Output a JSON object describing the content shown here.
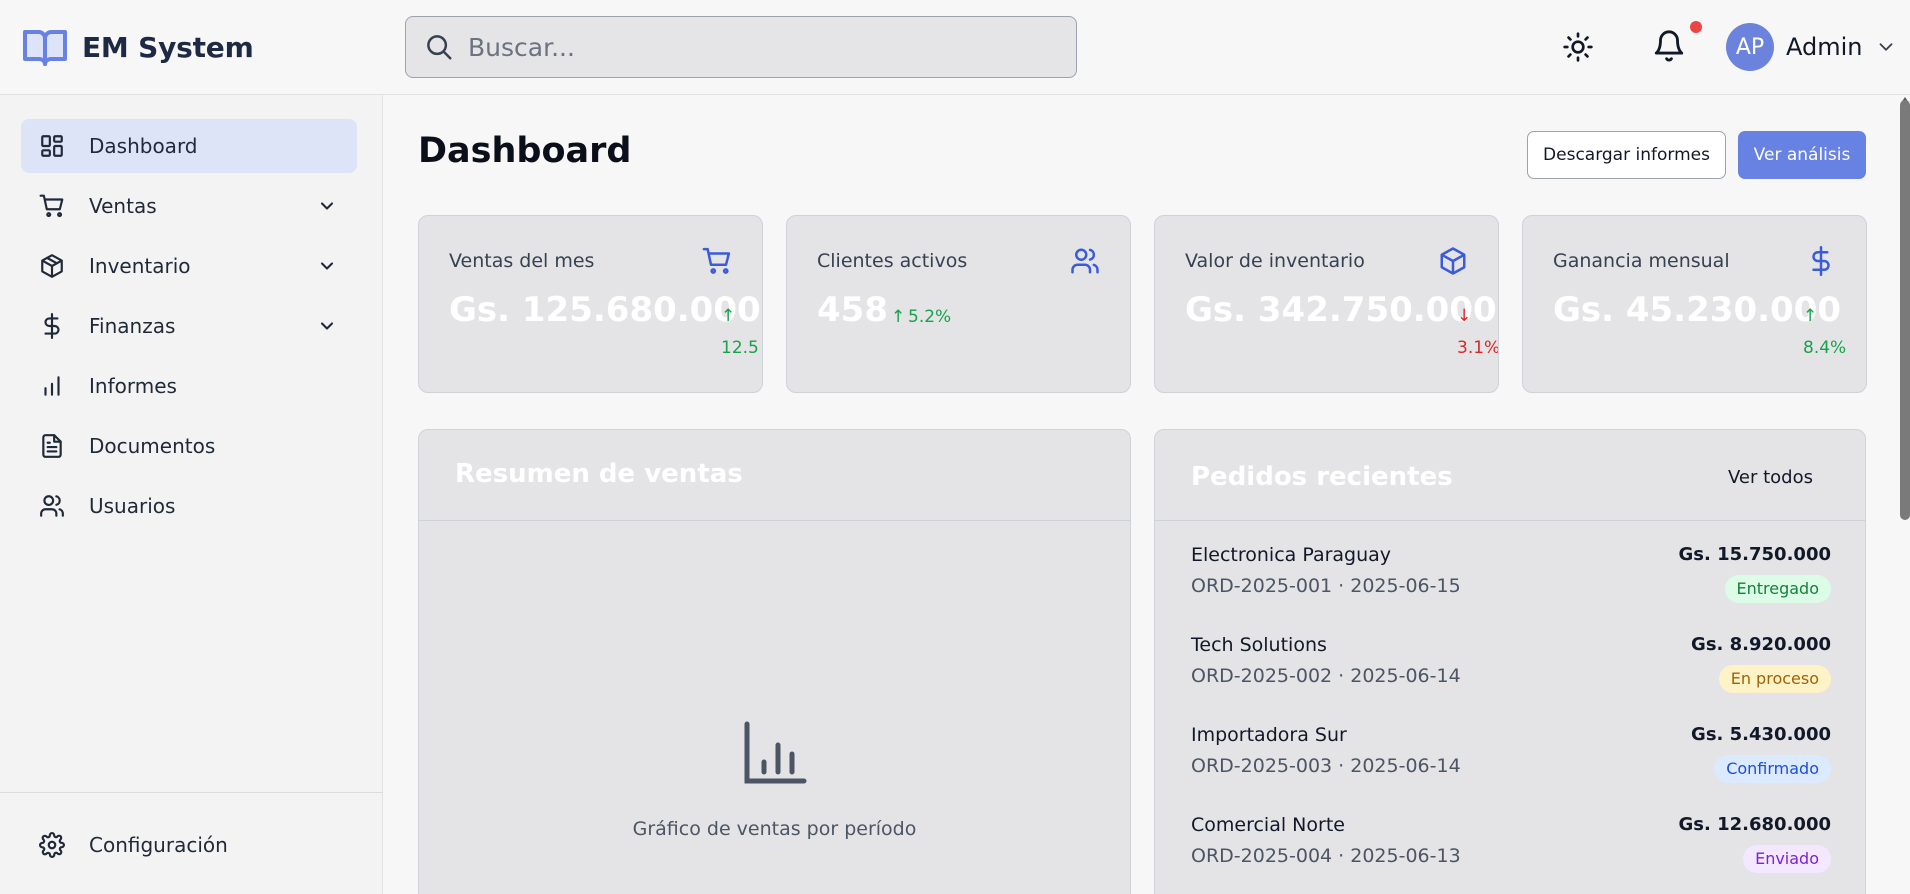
{
  "app": {
    "name": "EM System"
  },
  "search": {
    "placeholder": "Buscar..."
  },
  "user": {
    "initials": "AP",
    "name": "Admin"
  },
  "colors": {
    "accent": "#6782e2",
    "active_nav": "#dde4f8",
    "positive": "#16a34a",
    "negative": "#dc2626",
    "notification": "#ef4444"
  },
  "sidebar": {
    "items": [
      {
        "label": "Dashboard",
        "icon": "dashboard-icon",
        "active": true,
        "has_submenu": false
      },
      {
        "label": "Ventas",
        "icon": "cart-icon",
        "active": false,
        "has_submenu": true
      },
      {
        "label": "Inventario",
        "icon": "package-icon",
        "active": false,
        "has_submenu": true
      },
      {
        "label": "Finanzas",
        "icon": "dollar-icon",
        "active": false,
        "has_submenu": true
      },
      {
        "label": "Informes",
        "icon": "bar-chart-icon",
        "active": false,
        "has_submenu": false
      },
      {
        "label": "Documentos",
        "icon": "document-icon",
        "active": false,
        "has_submenu": false
      },
      {
        "label": "Usuarios",
        "icon": "users-icon",
        "active": false,
        "has_submenu": false
      }
    ],
    "settings_label": "Configuración"
  },
  "main": {
    "title": "Dashboard",
    "download_button": "Descargar informes",
    "analysis_button": "Ver análisis",
    "stats": [
      {
        "label": "Ventas del mes",
        "value": "Gs. 125.680.000",
        "arrow": "↑",
        "change": "12.5",
        "trend": "up",
        "icon": "cart-icon"
      },
      {
        "label": "Clientes activos",
        "value": "458",
        "arrow": "↑",
        "change": "5.2%",
        "trend": "up",
        "icon": "users-icon"
      },
      {
        "label": "Valor de inventario",
        "value": "Gs. 342.750.000",
        "arrow": "↓",
        "change": "3.1%",
        "trend": "down",
        "icon": "package-icon"
      },
      {
        "label": "Ganancia mensual",
        "value": "Gs. 45.230.000",
        "arrow": "↑",
        "change": "8.4%",
        "trend": "up",
        "icon": "dollar-icon"
      }
    ],
    "sales_panel": {
      "title": "Resumen de ventas",
      "placeholder": "Gráfico de ventas por período"
    },
    "orders_panel": {
      "title": "Pedidos recientes",
      "view_all": "Ver todos",
      "orders": [
        {
          "customer": "Electronica Paraguay",
          "meta": "ORD-2025-001 · 2025-06-15",
          "amount": "Gs. 15.750.000",
          "status": "Entregado"
        },
        {
          "customer": "Tech Solutions",
          "meta": "ORD-2025-002 · 2025-06-14",
          "amount": "Gs. 8.920.000",
          "status": "En proceso"
        },
        {
          "customer": "Importadora Sur",
          "meta": "ORD-2025-003 · 2025-06-14",
          "amount": "Gs. 5.430.000",
          "status": "Confirmado"
        },
        {
          "customer": "Comercial Norte",
          "meta": "ORD-2025-004 · 2025-06-13",
          "amount": "Gs. 12.680.000",
          "status": "Enviado"
        }
      ]
    }
  }
}
